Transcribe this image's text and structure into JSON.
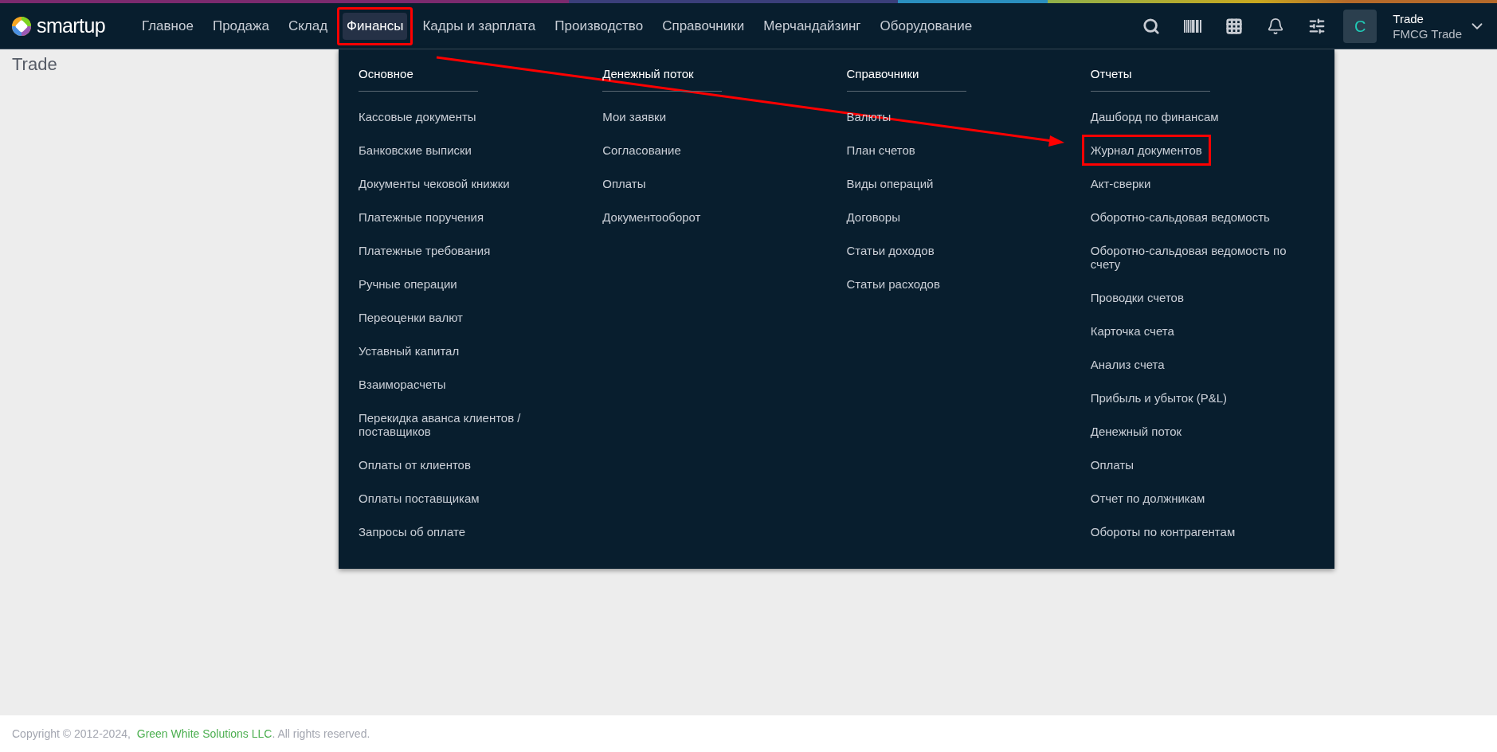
{
  "header": {
    "logo": "smartup",
    "nav": [
      {
        "label": "Главное",
        "selected": false,
        "highlighted": false
      },
      {
        "label": "Продажа",
        "selected": false,
        "highlighted": false
      },
      {
        "label": "Склад",
        "selected": false,
        "highlighted": false
      },
      {
        "label": "Финансы",
        "selected": true,
        "highlighted": true
      },
      {
        "label": "Кадры и зарплата",
        "selected": false,
        "highlighted": false
      },
      {
        "label": "Производство",
        "selected": false,
        "highlighted": false
      },
      {
        "label": "Справочники",
        "selected": false,
        "highlighted": false
      },
      {
        "label": "Мерчандайзинг",
        "selected": false,
        "highlighted": false
      },
      {
        "label": "Оборудование",
        "selected": false,
        "highlighted": false
      }
    ],
    "avatar": "C",
    "user": {
      "name": "Trade",
      "company": "FMCG Trade"
    }
  },
  "page_title": "Trade",
  "menu": {
    "columns": [
      {
        "title": "Основное",
        "items": [
          {
            "label": "Кассовые документы",
            "highlighted": false
          },
          {
            "label": "Банковские выписки",
            "highlighted": false
          },
          {
            "label": "Документы чековой книжки",
            "highlighted": false
          },
          {
            "label": "Платежные поручения",
            "highlighted": false
          },
          {
            "label": "Платежные требования",
            "highlighted": false
          },
          {
            "label": "Ручные операции",
            "highlighted": false
          },
          {
            "label": "Переоценки валют",
            "highlighted": false
          },
          {
            "label": "Уставный капитал",
            "highlighted": false
          },
          {
            "label": "Взаиморасчеты",
            "highlighted": false
          },
          {
            "label": "Перекидка аванса клиентов / поставщиков",
            "highlighted": false
          },
          {
            "label": "Оплаты от клиентов",
            "highlighted": false
          },
          {
            "label": "Оплаты поставщикам",
            "highlighted": false
          },
          {
            "label": "Запросы об оплате",
            "highlighted": false
          }
        ]
      },
      {
        "title": "Денежный поток",
        "items": [
          {
            "label": "Мои заявки",
            "highlighted": false
          },
          {
            "label": "Согласование",
            "highlighted": false
          },
          {
            "label": "Оплаты",
            "highlighted": false
          },
          {
            "label": "Документооборот",
            "highlighted": false
          }
        ]
      },
      {
        "title": "Справочники",
        "items": [
          {
            "label": "Валюты",
            "highlighted": false
          },
          {
            "label": "План счетов",
            "highlighted": false
          },
          {
            "label": "Виды операций",
            "highlighted": false
          },
          {
            "label": "Договоры",
            "highlighted": false
          },
          {
            "label": "Статьи доходов",
            "highlighted": false
          },
          {
            "label": "Статьи расходов",
            "highlighted": false
          }
        ]
      },
      {
        "title": "Отчеты",
        "items": [
          {
            "label": "Дашборд по финансам",
            "highlighted": false
          },
          {
            "label": "Журнал документов",
            "highlighted": true
          },
          {
            "label": "Акт-сверки",
            "highlighted": false
          },
          {
            "label": "Оборотно-сальдовая ведомость",
            "highlighted": false
          },
          {
            "label": "Оборотно-сальдовая ведомость по счету",
            "highlighted": false
          },
          {
            "label": "Проводки счетов",
            "highlighted": false
          },
          {
            "label": "Карточка счета",
            "highlighted": false
          },
          {
            "label": "Анализ счета",
            "highlighted": false
          },
          {
            "label": "Прибыль и убыток (P&L)",
            "highlighted": false
          },
          {
            "label": "Денежный поток",
            "highlighted": false
          },
          {
            "label": "Оплаты",
            "highlighted": false
          },
          {
            "label": "Отчет по должникам",
            "highlighted": false
          },
          {
            "label": "Обороты по контрагентам",
            "highlighted": false
          }
        ]
      }
    ]
  },
  "footer": {
    "copyright": "Copyright © 2012-2024, ",
    "company_link": "Green White Solutions LLC",
    "rights": ". All rights reserved."
  }
}
